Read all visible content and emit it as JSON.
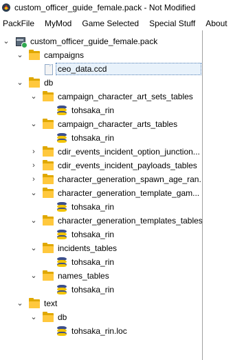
{
  "window": {
    "title": "custom_officer_guide_female.pack - Not Modified"
  },
  "menu": [
    "PackFile",
    "MyMod",
    "Game Selected",
    "Special Stuff",
    "About"
  ],
  "tree": {
    "root": "custom_officer_guide_female.pack",
    "campaigns": "campaigns",
    "ceo_data": "ceo_data.ccd",
    "db": "db",
    "campaign_character_art_sets_tables": "campaign_character_art_sets_tables",
    "rin1": "tohsaka_rin",
    "campaign_character_arts_tables": "campaign_character_arts_tables",
    "rin2": "tohsaka_rin",
    "cdir_events_incident_option_junction": "cdir_events_incident_option_junction...",
    "cdir_events_incident_payloads_tables": "cdir_events_incident_payloads_tables",
    "character_generation_spawn_age_ran": "character_generation_spawn_age_ran...",
    "character_generation_template_gam": "character_generation_template_gam...",
    "rin3": "tohsaka_rin",
    "character_generation_templates_tables": "character_generation_templates_tables",
    "rin4": "tohsaka_rin",
    "incidents_tables": "incidents_tables",
    "rin5": "tohsaka_rin",
    "names_tables": "names_tables",
    "rin6": "tohsaka_rin",
    "text": "text",
    "text_db": "db",
    "rin_loc": "tohsaka_rin.loc"
  },
  "colors": {
    "folder": "#ffc83d",
    "selection": "#e8f2fb"
  }
}
